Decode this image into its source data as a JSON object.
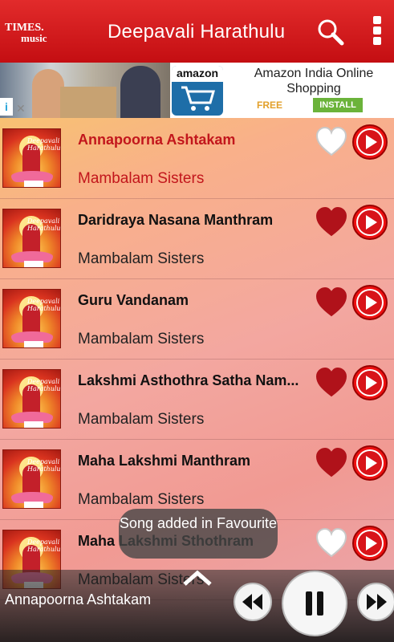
{
  "app_bar": {
    "logo_line1": "TIMES",
    "logo_line2": "music",
    "title": "Deepavali Harathulu",
    "search_icon": "search-icon",
    "menu_icon": "overflow-menu-icon"
  },
  "ad": {
    "brand": "amazon",
    "title": "Amazon India Online Shopping",
    "free": "FREE",
    "install": "INSTALL"
  },
  "thumb_text": "Deepavali Harathulu",
  "songs": [
    {
      "title": "Annapoorna Ashtakam",
      "artist": "Mambalam Sisters",
      "favourite": false,
      "active": true
    },
    {
      "title": "Daridraya Nasana Manthram",
      "artist": "Mambalam Sisters",
      "favourite": true,
      "active": false
    },
    {
      "title": "Guru Vandanam",
      "artist": "Mambalam Sisters",
      "favourite": true,
      "active": false
    },
    {
      "title": "Lakshmi Asthothra Satha Nam...",
      "artist": "Mambalam Sisters",
      "favourite": true,
      "active": false
    },
    {
      "title": "Maha Lakshmi Manthram",
      "artist": "Mambalam Sisters",
      "favourite": true,
      "active": false
    },
    {
      "title": "Maha Lakshmi Sthothram",
      "artist": "Mambalam Sisters",
      "favourite": false,
      "active": false
    }
  ],
  "toast": "Song added in Favourite",
  "player": {
    "now_playing": "Annapoorna Ashtakam"
  },
  "colors": {
    "app_bar": "#d01a1e",
    "accent": "#c2161c",
    "heart": "#b0121a"
  }
}
